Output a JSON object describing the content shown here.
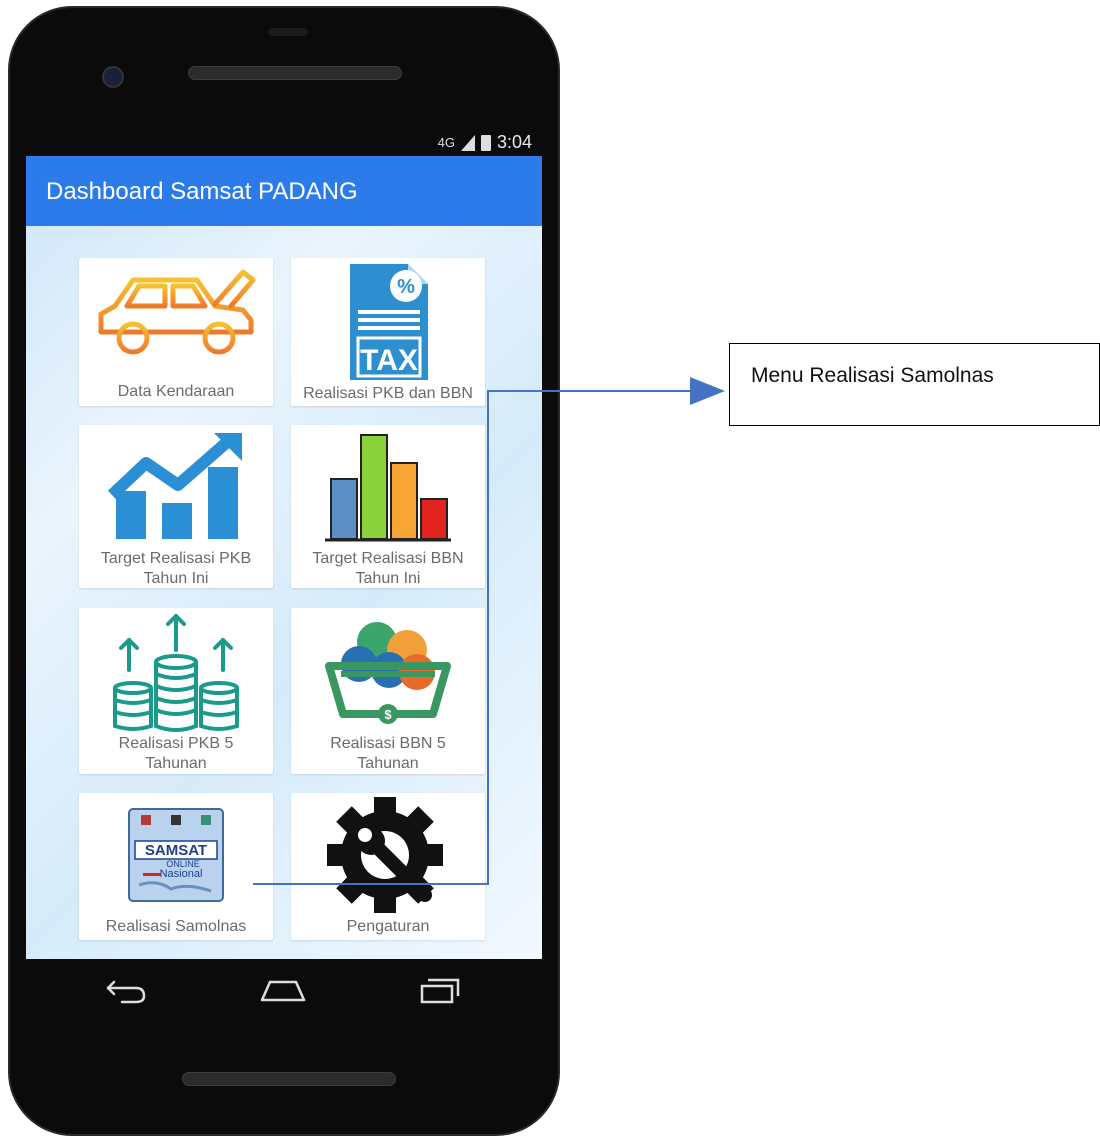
{
  "status_bar": {
    "signal": "4G",
    "time": "3:04"
  },
  "app_bar": {
    "title": "Dashboard Samsat PADANG"
  },
  "menu": {
    "items": [
      {
        "label": "Data Kendaraan"
      },
      {
        "label": "Realisasi PKB dan BBN"
      },
      {
        "label": "Target Realisasi PKB\nTahun Ini"
      },
      {
        "label": "Target Realisasi BBN\nTahun Ini"
      },
      {
        "label": "Realisasi PKB 5\nTahunan"
      },
      {
        "label": "Realisasi BBN 5\nTahunan"
      },
      {
        "label": "Realisasi Samolnas"
      },
      {
        "label": "Pengaturan"
      }
    ],
    "icons": [
      "car-icon",
      "tax-document-icon",
      "growth-chart-icon",
      "bar-chart-icon",
      "coins-growth-icon",
      "shopping-basket-icon",
      "samsat-logo-icon",
      "settings-gear-icon"
    ]
  },
  "tax_icon_text": {
    "percent": "%",
    "tax": "TAX"
  },
  "samsat_logo": {
    "line1": "SAMSAT",
    "line2": "ONLINE",
    "line3": "Nasional"
  },
  "nav_bar": {
    "icons": [
      "back-icon",
      "home-icon",
      "recents-icon"
    ]
  },
  "annotation": {
    "text": "Menu Realisasi Samolnas"
  },
  "colors": {
    "app_bar": "#2b7bea",
    "arrow": "#4472c4",
    "tile_text": "#6b6b6b"
  }
}
